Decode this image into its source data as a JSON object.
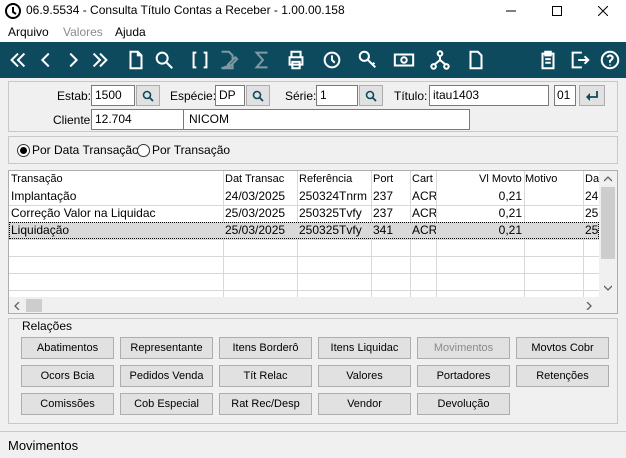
{
  "window": {
    "title": "06.9.5534 - Consulta Título Contas a Receber - 1.00.00.158",
    "minimize_icon": "minimize-icon",
    "maximize_icon": "maximize-icon",
    "close_icon": "close-icon"
  },
  "menu": [
    "Arquivo",
    "Valores",
    "Ajuda"
  ],
  "toolbar": {
    "icons": [
      "first-icon",
      "previous-icon",
      "next-icon",
      "last-icon",
      "document-icon",
      "search-icon",
      "brackets-icon",
      "edit-icon",
      "sum-icon",
      "print-icon",
      "history-icon",
      "key-icon",
      "money-icon",
      "network-icon",
      "file-icon",
      "clipboard-icon",
      "exit-icon",
      "help-icon"
    ],
    "background": "#0e4a5e"
  },
  "header": {
    "estab_label": "Estab:",
    "estab_value": "1500",
    "especie_label": "Espécie:",
    "especie_value": "DP",
    "serie_label": "Série:",
    "serie_value": "1",
    "titulo_label": "Título:",
    "titulo_value": "itau1403",
    "parcela_value": "01",
    "cliente_label": "Cliente:",
    "cliente_code": "12.704",
    "cliente_name": "NICOM"
  },
  "options": {
    "por_data": "Por Data Transação",
    "por_transacao": "Por Transação",
    "selected": "por_data"
  },
  "grid": {
    "columns": [
      "Transação",
      "Dat Transac",
      "Referência",
      "Port",
      "Cart",
      "Vl Movto",
      "Motivo",
      "Da"
    ],
    "rows": [
      [
        "Implantação",
        "24/03/2025",
        "250324Tnrm",
        "237",
        "ACR",
        "0,21",
        "",
        "24"
      ],
      [
        "Correção Valor na Liquidac",
        "25/03/2025",
        "250325Tvfy",
        "237",
        "ACR",
        "0,21",
        "",
        "25"
      ],
      [
        "Liquidação",
        "25/03/2025",
        "250325Tvfy",
        "341",
        "ACR",
        "0,21",
        "",
        "25"
      ]
    ],
    "selected_row": 2
  },
  "relacoes": {
    "title": "Relações",
    "buttons": [
      [
        "Abatimentos",
        "Representante",
        "Itens Borderô",
        "Itens Liquidac",
        "Movimentos",
        "Movtos Cobr"
      ],
      [
        "Ocors Bcia",
        "Pedidos Venda",
        "Tít  Relac",
        "Valores",
        "Portadores",
        "Retenções"
      ],
      [
        "Comissões",
        "Cob Especial",
        "Rat Rec/Desp",
        "Vendor",
        "Devolução"
      ]
    ],
    "disabled": [
      "Movimentos"
    ]
  },
  "status": {
    "text": "Movimentos"
  }
}
